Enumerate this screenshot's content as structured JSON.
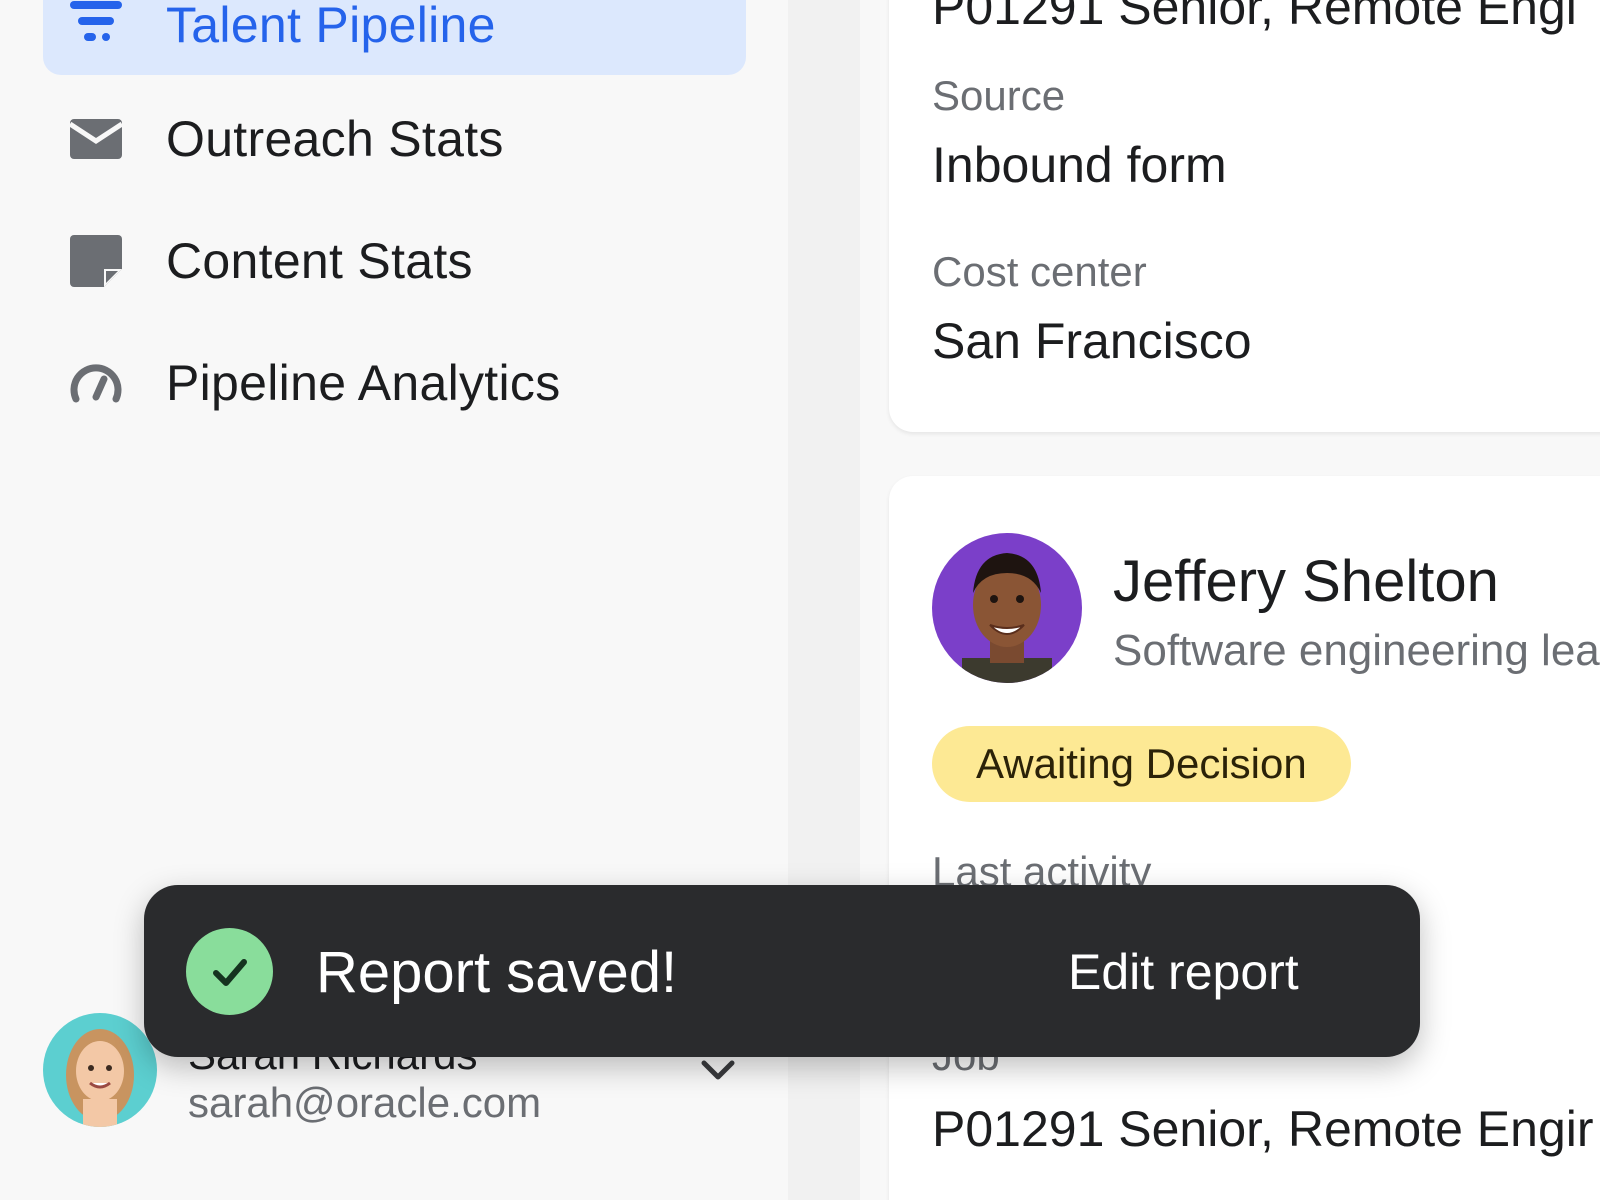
{
  "sidebar": {
    "items": [
      {
        "label": "Talent Pipeline",
        "icon": "filter-lines-icon",
        "active": true
      },
      {
        "label": "Outreach Stats",
        "icon": "envelope-icon",
        "active": false
      },
      {
        "label": "Content Stats",
        "icon": "sticky-note-icon",
        "active": false
      },
      {
        "label": "Pipeline Analytics",
        "icon": "gauge-icon",
        "active": false
      }
    ],
    "account": {
      "name": "Sarah Richards",
      "email": "sarah@oracle.com"
    }
  },
  "main": {
    "details_card": {
      "heading_partial": "P01291 Senior, Remote Engi",
      "fields": [
        {
          "label": "Source",
          "value": "Inbound form"
        },
        {
          "label": "Cost center",
          "value": "San Francisco"
        }
      ]
    },
    "candidate_card": {
      "name": "Jeffery Shelton",
      "title": "Software engineering lea",
      "status": "Awaiting Decision",
      "last_activity_label": "Last activity",
      "job_label": "Job",
      "job_value": "P01291 Senior, Remote Engir"
    }
  },
  "toast": {
    "message": "Report saved!",
    "action": "Edit report"
  },
  "colors": {
    "accent": "#2563eb",
    "active_bg": "#dce8fd",
    "badge_bg": "#fde994",
    "toast_bg": "#2a2b2d",
    "success": "#89dd9b"
  }
}
